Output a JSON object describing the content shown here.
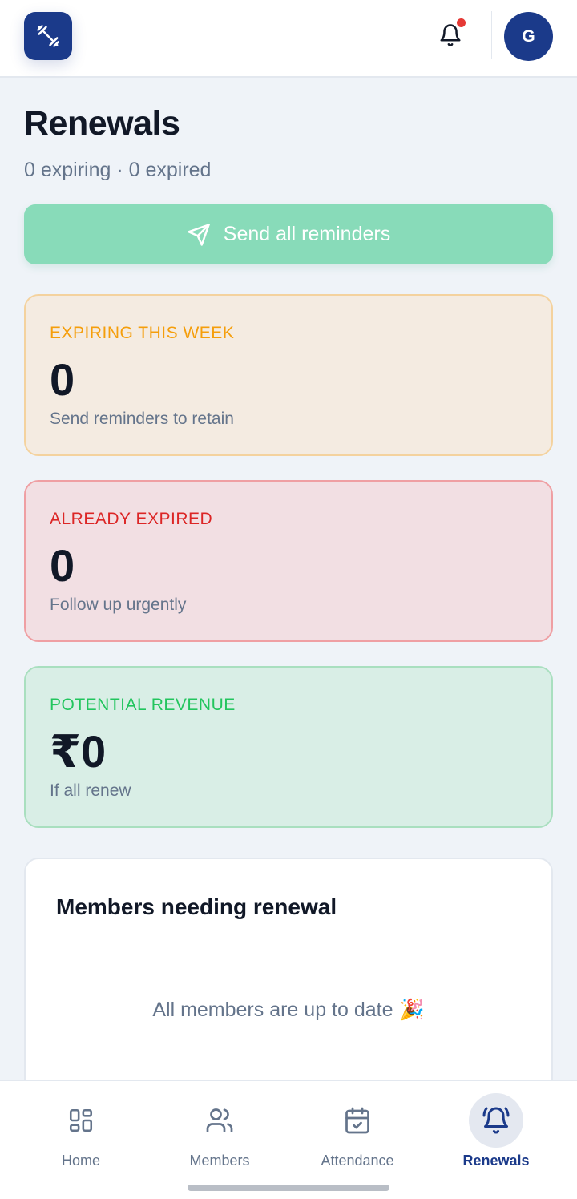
{
  "topbar": {
    "logo_icon": "dumbbell-icon",
    "notification_icon": "bell-icon",
    "notification_dot_color": "#e53935",
    "avatar_initial": "G"
  },
  "header": {
    "title": "Renewals",
    "subtitle": "0 expiring · 0 expired"
  },
  "send_button": {
    "label": "Send all reminders",
    "icon": "send-icon"
  },
  "stats": {
    "expiring": {
      "label": "EXPIRING THIS WEEK",
      "value": "0",
      "note": "Send reminders to retain",
      "accent": "#f59e0b"
    },
    "expired": {
      "label": "ALREADY EXPIRED",
      "value": "0",
      "note": "Follow up urgently",
      "accent": "#dc2626"
    },
    "revenue": {
      "label": "POTENTIAL REVENUE",
      "value": "₹0",
      "note": "If all renew",
      "accent": "#22c55e"
    }
  },
  "members": {
    "title": "Members needing renewal",
    "empty_text": "All members are up to date",
    "empty_emoji": "🎉"
  },
  "nav": {
    "items": [
      {
        "label": "Home",
        "icon": "grid-icon"
      },
      {
        "label": "Members",
        "icon": "users-icon"
      },
      {
        "label": "Attendance",
        "icon": "calendar-check-icon"
      },
      {
        "label": "Renewals",
        "icon": "bell-ring-icon",
        "active": true
      }
    ]
  },
  "colors": {
    "brand": "#1b3a8a",
    "send_button_bg": "#88dbb9",
    "page_bg": "#eff3f8"
  }
}
